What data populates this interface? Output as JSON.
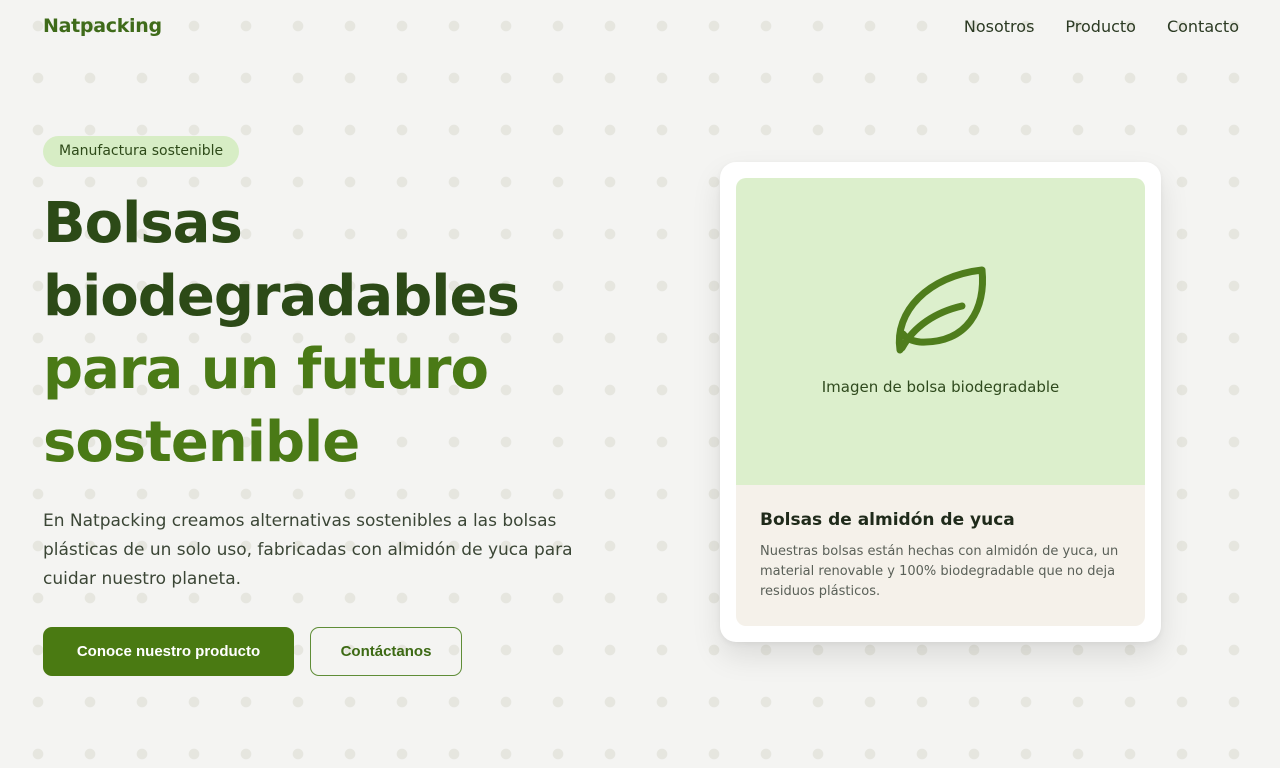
{
  "nav": {
    "logo": "Natpacking",
    "links": [
      "Nosotros",
      "Producto",
      "Contacto"
    ]
  },
  "hero": {
    "badge": "Manufactura sostenible",
    "title_line1": "Bolsas",
    "title_line2": "biodegradables",
    "title_line3": "para un futuro",
    "title_line4": "sostenible",
    "description": "En Natpacking creamos alternativas sostenibles a las bolsas plásticas de un solo uso, fabricadas con almidón de yuca para cuidar nuestro planeta.",
    "primary_button": "Conoce nuestro producto",
    "secondary_button": "Contáctanos"
  },
  "card": {
    "image_icon": "leaf-icon",
    "image_caption": "Imagen de bolsa biodegradable",
    "title": "Bolsas de almidón de yuca",
    "text": "Nuestras bolsas están hechas con almidón de yuca, un material renovable y 100% biodegradable que no deja residuos plásticos."
  },
  "colors": {
    "brand_green": "#4a7a12",
    "dark_green": "#2c4a17",
    "badge_bg": "#d7edc5",
    "media_bg": "#dcefcc",
    "card_body_bg": "#f5f1ea"
  }
}
